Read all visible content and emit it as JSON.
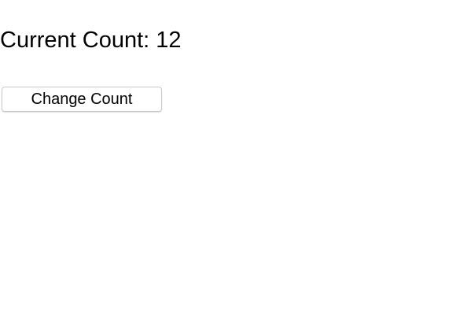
{
  "counter": {
    "label": "Current Count:",
    "value": "12"
  },
  "actions": {
    "change_count_label": "Change Count"
  }
}
